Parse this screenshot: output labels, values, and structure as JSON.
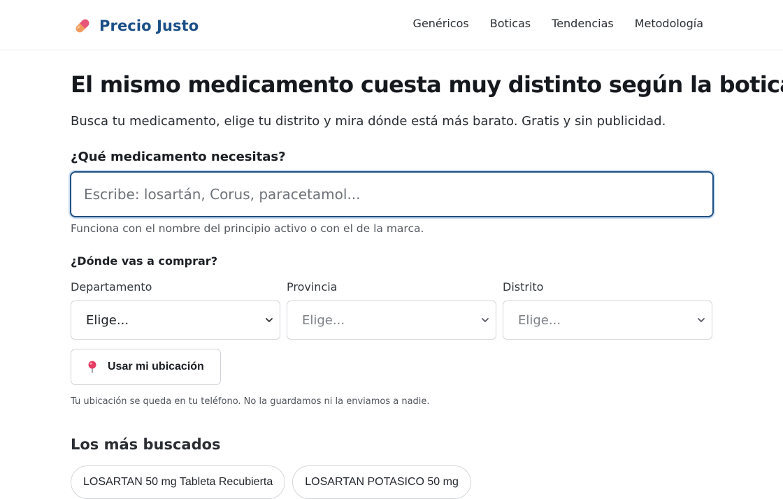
{
  "header": {
    "brand": "Precio Justo",
    "brand_icon": "pill-icon",
    "nav": [
      "Genéricos",
      "Boticas",
      "Tendencias",
      "Metodología"
    ]
  },
  "hero": {
    "title": "El mismo medicamento cuesta muy distinto según la botica",
    "subtitle": "Busca tu medicamento, elige tu distrito y mira dónde está más barato. Gratis y sin publicidad."
  },
  "search": {
    "label": "¿Qué medicamento necesitas?",
    "value": "",
    "placeholder": "Escribe: losartán, Corus, paracetamol...",
    "help": "Funciona con el nombre del principio activo o con el de la marca."
  },
  "location": {
    "label": "¿Dónde vas a comprar?",
    "fields": [
      {
        "label": "Departamento",
        "value": "Elige...",
        "enabled": true
      },
      {
        "label": "Provincia",
        "value": "Elige...",
        "enabled": false
      },
      {
        "label": "Distrito",
        "value": "Elige...",
        "enabled": false
      }
    ],
    "use_location_button": "Usar mi ubicación",
    "pin_icon": "map-pin-icon",
    "privacy_note": "Tu ubicación se queda en tu teléfono. No la guardamos ni la enviamos a nadie."
  },
  "popular": {
    "title": "Los más buscados",
    "chips": [
      "LOSARTAN 50 mg Tableta Recubierta",
      "LOSARTAN POTASICO 50 mg"
    ]
  },
  "colors": {
    "brand": "#1a4e86",
    "focus_border": "#1f4f80",
    "pill_orange": "#f08a4b",
    "pill_pink": "#e8557a"
  }
}
